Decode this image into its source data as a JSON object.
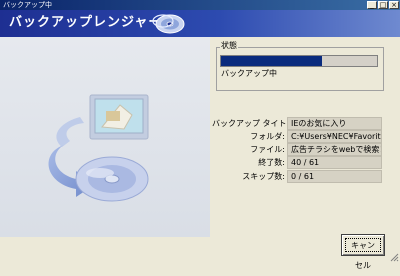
{
  "window": {
    "title": "バックアップ中",
    "controls": {
      "minimize": "_",
      "maximize": "□",
      "close": "×"
    }
  },
  "header": {
    "title": "バックアップレンジャー",
    "icon": "cd-disc-icon"
  },
  "status": {
    "group_label": "状態",
    "progress": 0.65,
    "message": "バックアップ中"
  },
  "info": [
    {
      "label": "バックアップ タイトル:",
      "value": "IEのお気に入り"
    },
    {
      "label": "フォルダ:",
      "value": "C:¥Users¥NEC¥Favorites¥F"
    },
    {
      "label": "ファイル:",
      "value": "広告チラシをwebで検索！広"
    },
    {
      "label": "終了数:",
      "value": "40 / 61"
    },
    {
      "label": "スキップ数:",
      "value": "0 / 61"
    }
  ],
  "buttons": {
    "cancel": "キャンセル"
  },
  "colors": {
    "header": "#1e2f92",
    "progress": "#0a2b7d",
    "window_bg": "#ece9d8"
  }
}
